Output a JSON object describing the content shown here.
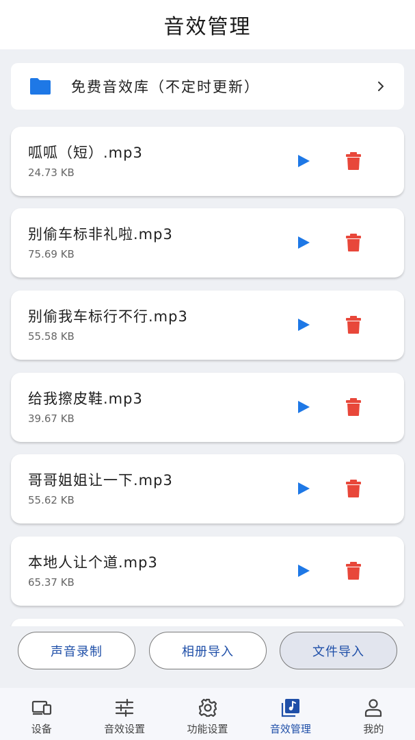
{
  "header": {
    "title": "音效管理"
  },
  "library": {
    "label": "免费音效库（不定时更新）",
    "icon": "folder-icon"
  },
  "sounds": [
    {
      "name": "呱呱（短）.mp3",
      "size": "24.73 KB"
    },
    {
      "name": "别偷车标非礼啦.mp3",
      "size": "75.69 KB"
    },
    {
      "name": "别偷我车标行不行.mp3",
      "size": "55.58 KB"
    },
    {
      "name": "给我擦皮鞋.mp3",
      "size": "39.67 KB"
    },
    {
      "name": "哥哥姐姐让一下.mp3",
      "size": "55.62 KB"
    },
    {
      "name": "本地人让个道.mp3",
      "size": "65.37 KB"
    }
  ],
  "actions": {
    "record": "声音录制",
    "album_import": "相册导入",
    "file_import": "文件导入"
  },
  "nav": [
    {
      "label": "设备",
      "icon": "device-icon"
    },
    {
      "label": "音效设置",
      "icon": "sliders-icon"
    },
    {
      "label": "功能设置",
      "icon": "gear-icon"
    },
    {
      "label": "音效管理",
      "icon": "music-library-icon",
      "active": true
    },
    {
      "label": "我的",
      "icon": "person-icon"
    }
  ],
  "colors": {
    "accent": "#1f4fa8",
    "play": "#1e78e6",
    "delete": "#e8473a",
    "folder": "#1e78e6",
    "background": "#eef0f4"
  }
}
